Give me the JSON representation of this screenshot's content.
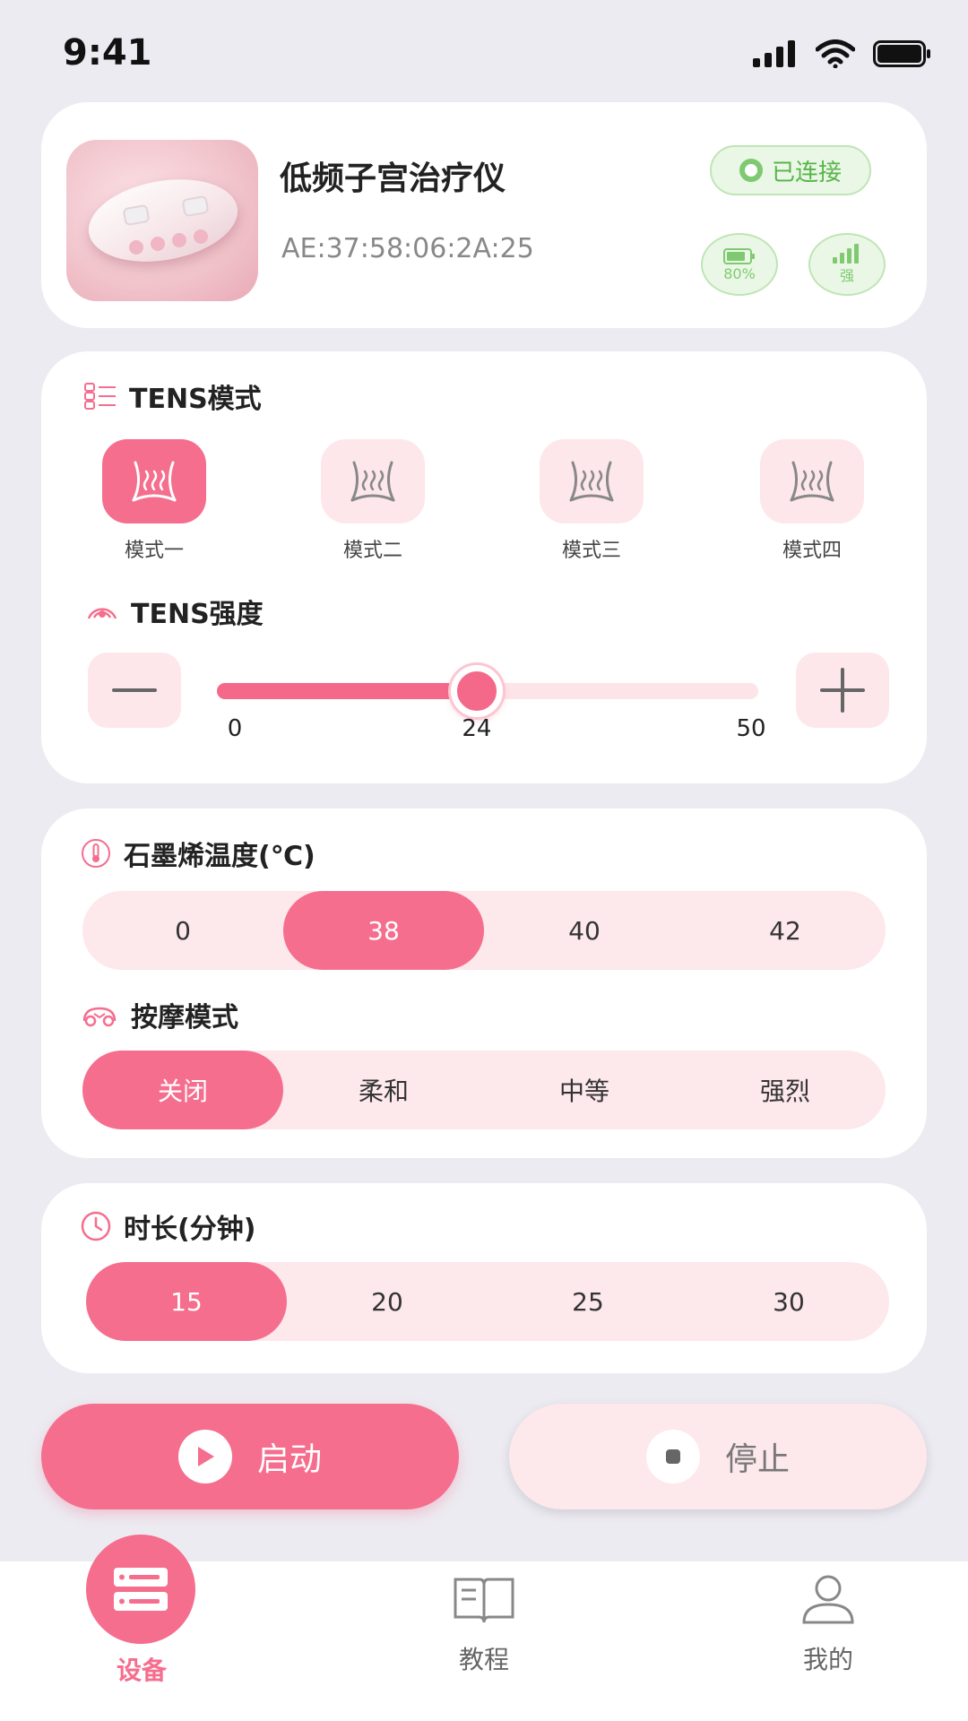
{
  "status_bar": {
    "time": "9:41"
  },
  "device": {
    "name": "低频子宫治疗仪",
    "mac": "AE:37:58:06:2A:25",
    "status": "已连接",
    "battery_label": "80%",
    "signal_label": "强"
  },
  "tens": {
    "mode_title": "TENS模式",
    "modes": [
      {
        "label": "模式一",
        "active": true
      },
      {
        "label": "模式二",
        "active": false
      },
      {
        "label": "模式三",
        "active": false
      },
      {
        "label": "模式四",
        "active": false
      }
    ],
    "intensity_title": "TENS强度",
    "intensity": {
      "min": "0",
      "value": "24",
      "max": "50",
      "value_num": 24,
      "min_num": 0,
      "max_num": 50
    }
  },
  "graphene": {
    "title": "石墨烯温度(℃)",
    "options": [
      "0",
      "38",
      "40",
      "42"
    ],
    "selected": "38"
  },
  "massage": {
    "title": "按摩模式",
    "options": [
      "关闭",
      "柔和",
      "中等",
      "强烈"
    ],
    "selected": "关闭"
  },
  "duration": {
    "title": "时长(分钟)",
    "options": [
      "15",
      "20",
      "25",
      "30"
    ],
    "selected": "15"
  },
  "actions": {
    "start": "启动",
    "stop": "停止"
  },
  "tabs": [
    {
      "label": "设备",
      "active": true
    },
    {
      "label": "教程",
      "active": false
    },
    {
      "label": "我的",
      "active": false
    }
  ],
  "colors": {
    "accent": "#f56e8e",
    "accent_light": "#fde8ec",
    "connected_green": "#58b44a"
  }
}
